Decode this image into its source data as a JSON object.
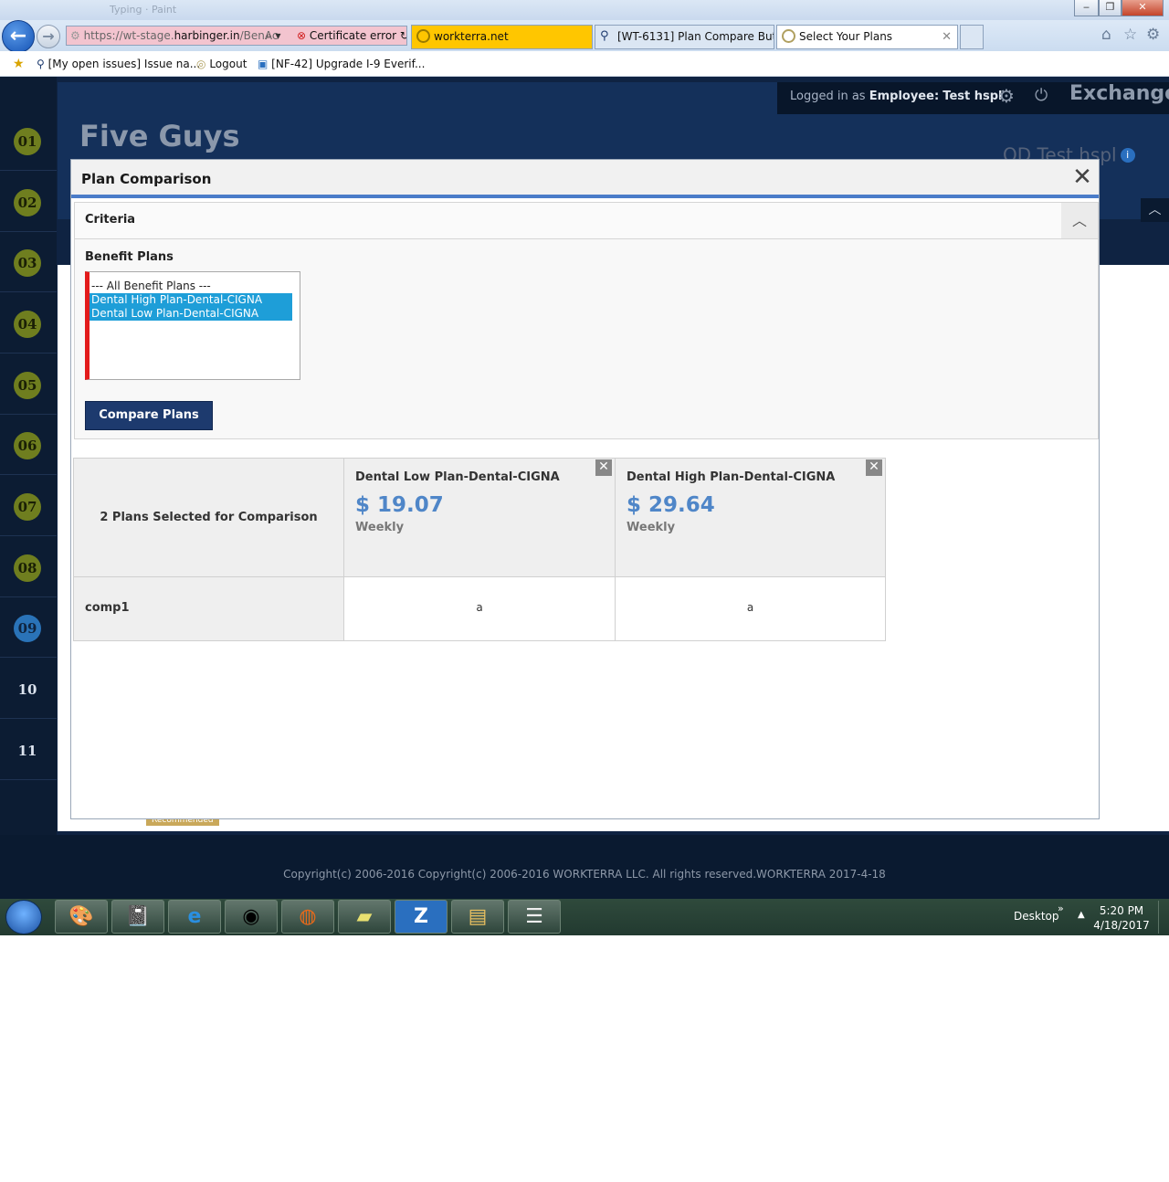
{
  "browser": {
    "window_title": "Typing · Paint",
    "address_prefix": "https://",
    "address_host_pre": "wt-stage.",
    "address_host": "harbinger.in",
    "address_path": "/BenAc",
    "cert_error": "Certificate error",
    "tabs": [
      {
        "label": "workterra.net"
      },
      {
        "label": "[WT-6131] Plan Compare Butt..."
      },
      {
        "label": "Select Your Plans"
      }
    ],
    "favorites": [
      {
        "label": "[My open issues] Issue na..."
      },
      {
        "label": "Logout"
      },
      {
        "label": "[NF-42] Upgrade I-9 Everif..."
      }
    ]
  },
  "app": {
    "company": "Five Guys",
    "login_prefix": "Logged in as",
    "login_role": "Employee:",
    "login_user": "Test hspl",
    "exchange_label": "Exchange",
    "od_label": "OD Test hspl",
    "recommended_badge": "Recommended",
    "steps": [
      "01",
      "02",
      "03",
      "04",
      "05",
      "06",
      "07",
      "08",
      "09",
      "10",
      "11"
    ],
    "active_step": "09",
    "copyright": "Copyright(c) 2006-2016 Copyright(c) 2006-2016 WORKTERRA LLC. All rights reserved.WORKTERRA 2017-4-18"
  },
  "modal": {
    "title": "Plan Comparison",
    "close_glyph": "✕",
    "criteria_title": "Criteria",
    "benefit_plans_label": "Benefit Plans",
    "options": [
      {
        "label": "--- All Benefit Plans ---",
        "selected": false
      },
      {
        "label": "Dental High Plan-Dental-CIGNA",
        "selected": true
      },
      {
        "label": "Dental Low Plan-Dental-CIGNA",
        "selected": true
      }
    ],
    "compare_button": "Compare Plans",
    "comparison": {
      "summary": "2 Plans Selected for Comparison",
      "plans": [
        {
          "name": "Dental Low Plan-Dental-CIGNA",
          "price": "$ 19.07",
          "frequency": "Weekly"
        },
        {
          "name": "Dental High Plan-Dental-CIGNA",
          "price": "$ 29.64",
          "frequency": "Weekly"
        }
      ],
      "rows": [
        {
          "label": "comp1",
          "values": [
            "a",
            "a"
          ]
        }
      ]
    }
  },
  "taskbar": {
    "desktop_label": "Desktop",
    "time": "5:20 PM",
    "date": "4/18/2017"
  }
}
